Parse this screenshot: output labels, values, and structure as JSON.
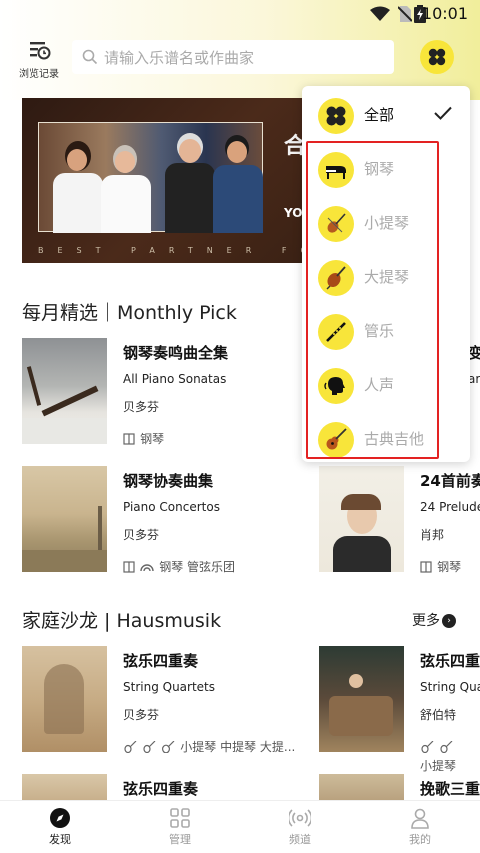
{
  "status": {
    "time": "10:01"
  },
  "header": {
    "history_label": "浏览记录",
    "search_placeholder": "请输入乐谱名或作曲家"
  },
  "banner": {
    "title": "合",
    "subtitle": "YO-",
    "tagline": "BEST PARTNER FOR"
  },
  "monthly": {
    "heading": "每月精选｜Monthly Pick",
    "cards": [
      {
        "title": "钢琴奏鸣曲全集",
        "subtitle": "All Piano Sonatas",
        "composer": "贝多芬",
        "instruments": "钢琴"
      },
      {
        "title": "钢琴协奏曲集",
        "subtitle": "Piano Concertos",
        "composer": "贝多芬",
        "instruments": "钢琴 管弦乐团"
      },
      {
        "title": "24首前奏",
        "subtitle": "24 Prelude",
        "composer": "肖邦",
        "instruments": "钢琴"
      },
      {
        "title": "变",
        "subtitle": "ari"
      }
    ]
  },
  "salon": {
    "heading": "家庭沙龙 | Hausmusik",
    "more": "更多",
    "cards": [
      {
        "title": "弦乐四重奏",
        "subtitle": "String Quartets",
        "composer": "贝多芬",
        "instruments": "小提琴 中提琴 大提..."
      },
      {
        "title": "弦乐四重",
        "subtitle": "String Qua",
        "composer": "舒伯特",
        "instruments": "小提琴"
      },
      {
        "title": "弦乐四重奏"
      },
      {
        "title": "挽歌三重"
      }
    ]
  },
  "dropdown": {
    "items": [
      {
        "label": "全部",
        "icon": "clover-icon",
        "selected": true
      },
      {
        "label": "钢琴",
        "icon": "grand-piano-icon"
      },
      {
        "label": "小提琴",
        "icon": "violin-icon"
      },
      {
        "label": "大提琴",
        "icon": "cello-icon"
      },
      {
        "label": "管乐",
        "icon": "flute-icon"
      },
      {
        "label": "人声",
        "icon": "voice-icon"
      },
      {
        "label": "古典吉他",
        "icon": "guitar-icon"
      }
    ]
  },
  "tabs": [
    {
      "label": "发现",
      "icon": "compass-icon",
      "active": true
    },
    {
      "label": "管理",
      "icon": "grid-icon"
    },
    {
      "label": "频道",
      "icon": "radio-icon"
    },
    {
      "label": "我的",
      "icon": "user-icon"
    }
  ],
  "colors": {
    "accent": "#f8e53a",
    "highlight": "#e32222"
  }
}
